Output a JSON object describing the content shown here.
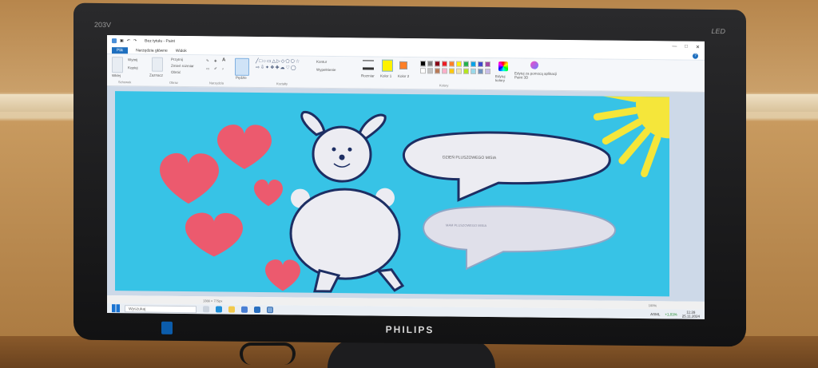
{
  "monitor": {
    "model": "203V",
    "type": "LED",
    "brand": "PHILIPS"
  },
  "window": {
    "title": "Bez tytułu - Paint",
    "controls": [
      "—",
      "□",
      "✕"
    ]
  },
  "menu": {
    "file": "Plik",
    "home": "Narzędzia główne",
    "view": "Widok"
  },
  "ribbon": {
    "paste": "Wklej",
    "cut": "Wytnij",
    "copy": "Kopiuj",
    "select": "Zaznacz",
    "crop": "Przytnij",
    "resize": "Zmień rozmiar",
    "rotate": "Obróć",
    "brushes": "Pędzle",
    "outline": "Kontur",
    "fill": "Wypełnienie",
    "size": "Rozmiar",
    "color1": "Kolor 1",
    "color2": "Kolor 2",
    "edit_colors": "Edytuj kolory",
    "paint3d": "Edytuj za pomocą aplikacji Paint 3D",
    "groups": {
      "clipboard": "Schowek",
      "image": "Obraz",
      "tools": "Narzędzia",
      "shapes": "Kształty",
      "colors": "Kolory"
    },
    "palette": [
      "#000000",
      "#7f7f7f",
      "#880015",
      "#ed1c24",
      "#ff7f27",
      "#fff200",
      "#22b14c",
      "#00a2e8",
      "#3f48cc",
      "#a349a4",
      "#ffffff",
      "#c3c3c3",
      "#b97a57",
      "#ffaec9",
      "#ffc90e",
      "#efe4b0",
      "#b5e61d",
      "#99d9ea",
      "#7092be",
      "#c8bfe7"
    ]
  },
  "drawing": {
    "bubble1_text": "DZIEŃ PLUSZOWEGO MISIA",
    "bubble2_text": "MAM PLUSZOWEGO MISIA",
    "colors": {
      "sky": "#37c3e6",
      "heart": "#ec5a6e",
      "sun": "#f5e63a",
      "bear": "#ececf2",
      "outline": "#1d2e63"
    }
  },
  "status": {
    "size": "1366 × 775px",
    "zoom": "100%"
  },
  "taskbar": {
    "search": "Wyszukaj",
    "ticker": "ASML",
    "ticker_change": "+1,03%",
    "time": "11:28",
    "date": "25.11.2024"
  }
}
